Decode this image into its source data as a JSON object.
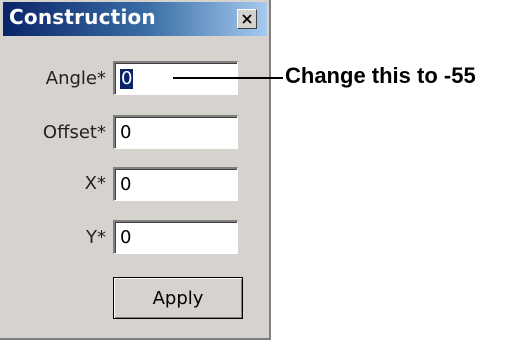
{
  "window": {
    "title": "Construction",
    "close_icon": "close-icon"
  },
  "form": {
    "fields": [
      {
        "label": "Angle*",
        "value": "0",
        "selected": true
      },
      {
        "label": "Offset*",
        "value": "0",
        "selected": false
      },
      {
        "label": "X*",
        "value": "0",
        "selected": false
      },
      {
        "label": "Y*",
        "value": "0",
        "selected": false
      }
    ],
    "apply_label": "Apply"
  },
  "annotation": {
    "text": "Change this to -55"
  },
  "colors": {
    "titlebar_start": "#0a246a",
    "titlebar_end": "#a6caf0",
    "dialog_bg": "#d6d3ce",
    "selection_bg": "#0a246a"
  }
}
